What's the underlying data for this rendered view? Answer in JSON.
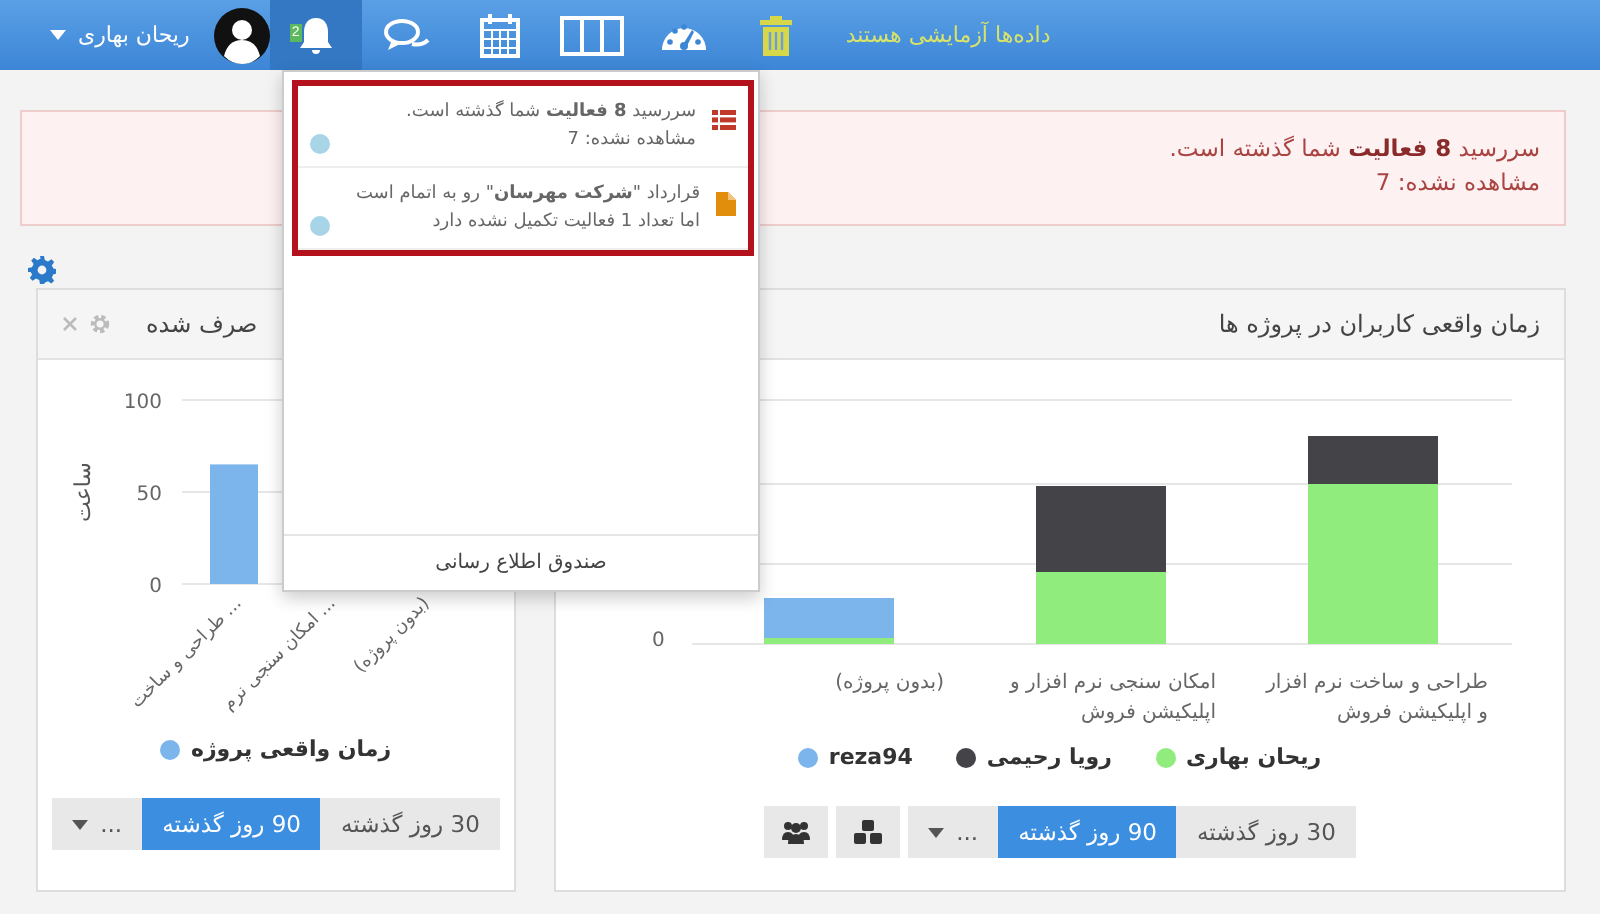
{
  "topbar": {
    "user_name": "ریحان بهاری",
    "notification_badge": "2",
    "notice": "داده‌ها آزمایشی هستند"
  },
  "alert": {
    "lines": [
      "سررسید  **8 فعالیت** شما گذشته است.",
      "مشاهده نشده: 7"
    ]
  },
  "notifications": {
    "items": [
      {
        "kind": "overdue",
        "color": "#c0392b",
        "text": "سررسید  **8 فعالیت** شما گذشته است.",
        "subtext": "مشاهده نشده: 7",
        "unread": true
      },
      {
        "kind": "contract",
        "color": "#e08e0b",
        "text": "قرارداد \"**شرکت مهرسان**\" رو به اتمام است اما تعداد 1 فعالیت تکمیل نشده دارد",
        "unread": true
      }
    ],
    "footer": "صندوق اطلاع رسانی"
  },
  "left_panel": {
    "title": "صرف شده",
    "chart_data": {
      "type": "bar",
      "ylabel": "ساعت",
      "categories": [
        "طراحی و ساخت ...",
        "امکان سنجی نرم ...",
        "(بدون پروژه)"
      ],
      "series": [
        {
          "name": "زمان واقعی پروژه",
          "color": "#7cb5ec",
          "values": [
            65,
            null,
            null
          ]
        }
      ],
      "yticks": [
        0,
        50,
        100
      ],
      "ylim": [
        0,
        100
      ]
    },
    "buttons": [
      {
        "label": "30 روز گذشته",
        "selected": false
      },
      {
        "label": "90 روز گذشته",
        "selected": true
      }
    ],
    "more": "..."
  },
  "right_panel": {
    "title": "زمان واقعی کاربران در پروژه ها",
    "y_tick": "0",
    "categories": [
      "طراحی و ساخت نرم افزار و اپلیکیشن فروش",
      "امکان سنجی نرم افزار و اپلیکیشن فروش",
      "(بدون پروژه)"
    ],
    "legend": [
      {
        "name": "ریحان بهاری",
        "color": "#90ed7d"
      },
      {
        "name": "رویا رحیمی",
        "color": "#434348"
      },
      {
        "name": "reza94",
        "color": "#7cb5ec"
      }
    ],
    "buttons": [
      {
        "label": "30 روز گذشته",
        "selected": false
      },
      {
        "label": "90 روز گذشته",
        "selected": true
      }
    ],
    "more": "..."
  }
}
